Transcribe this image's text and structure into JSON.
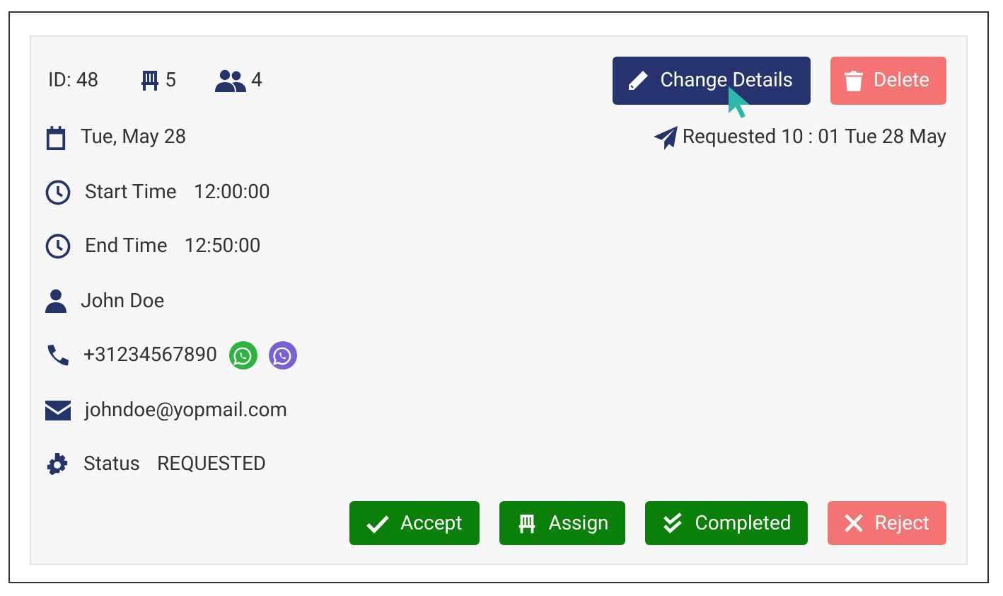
{
  "booking": {
    "id": "ID: 48",
    "seats": "5",
    "guests": "4"
  },
  "top_buttons": [
    {
      "label": "Change Details",
      "kind": "edit"
    },
    {
      "label": "Delete",
      "kind": "delete"
    }
  ],
  "requested": "Requested 10 : 01 Tue 28 May",
  "details": [
    {
      "kind": "date",
      "value": "Tue, May 28"
    },
    {
      "kind": "time",
      "label": "Start Time",
      "value": "12:00:00"
    },
    {
      "kind": "time",
      "label": "End Time",
      "value": "12:50:00"
    },
    {
      "kind": "name",
      "value": "John Doe"
    },
    {
      "kind": "phone",
      "value": "+31234567890",
      "apps": [
        {
          "kind": "whatsapp"
        },
        {
          "kind": "viber"
        }
      ]
    },
    {
      "kind": "email",
      "value": "johndoe@yopmail.com"
    },
    {
      "kind": "status",
      "label": "Status",
      "value": "REQUESTED"
    }
  ],
  "actions": [
    {
      "label": "Accept",
      "kind": "accept"
    },
    {
      "label": "Assign",
      "kind": "assign"
    },
    {
      "label": "Completed",
      "kind": "complete"
    },
    {
      "label": "Reject",
      "kind": "reject"
    }
  ]
}
